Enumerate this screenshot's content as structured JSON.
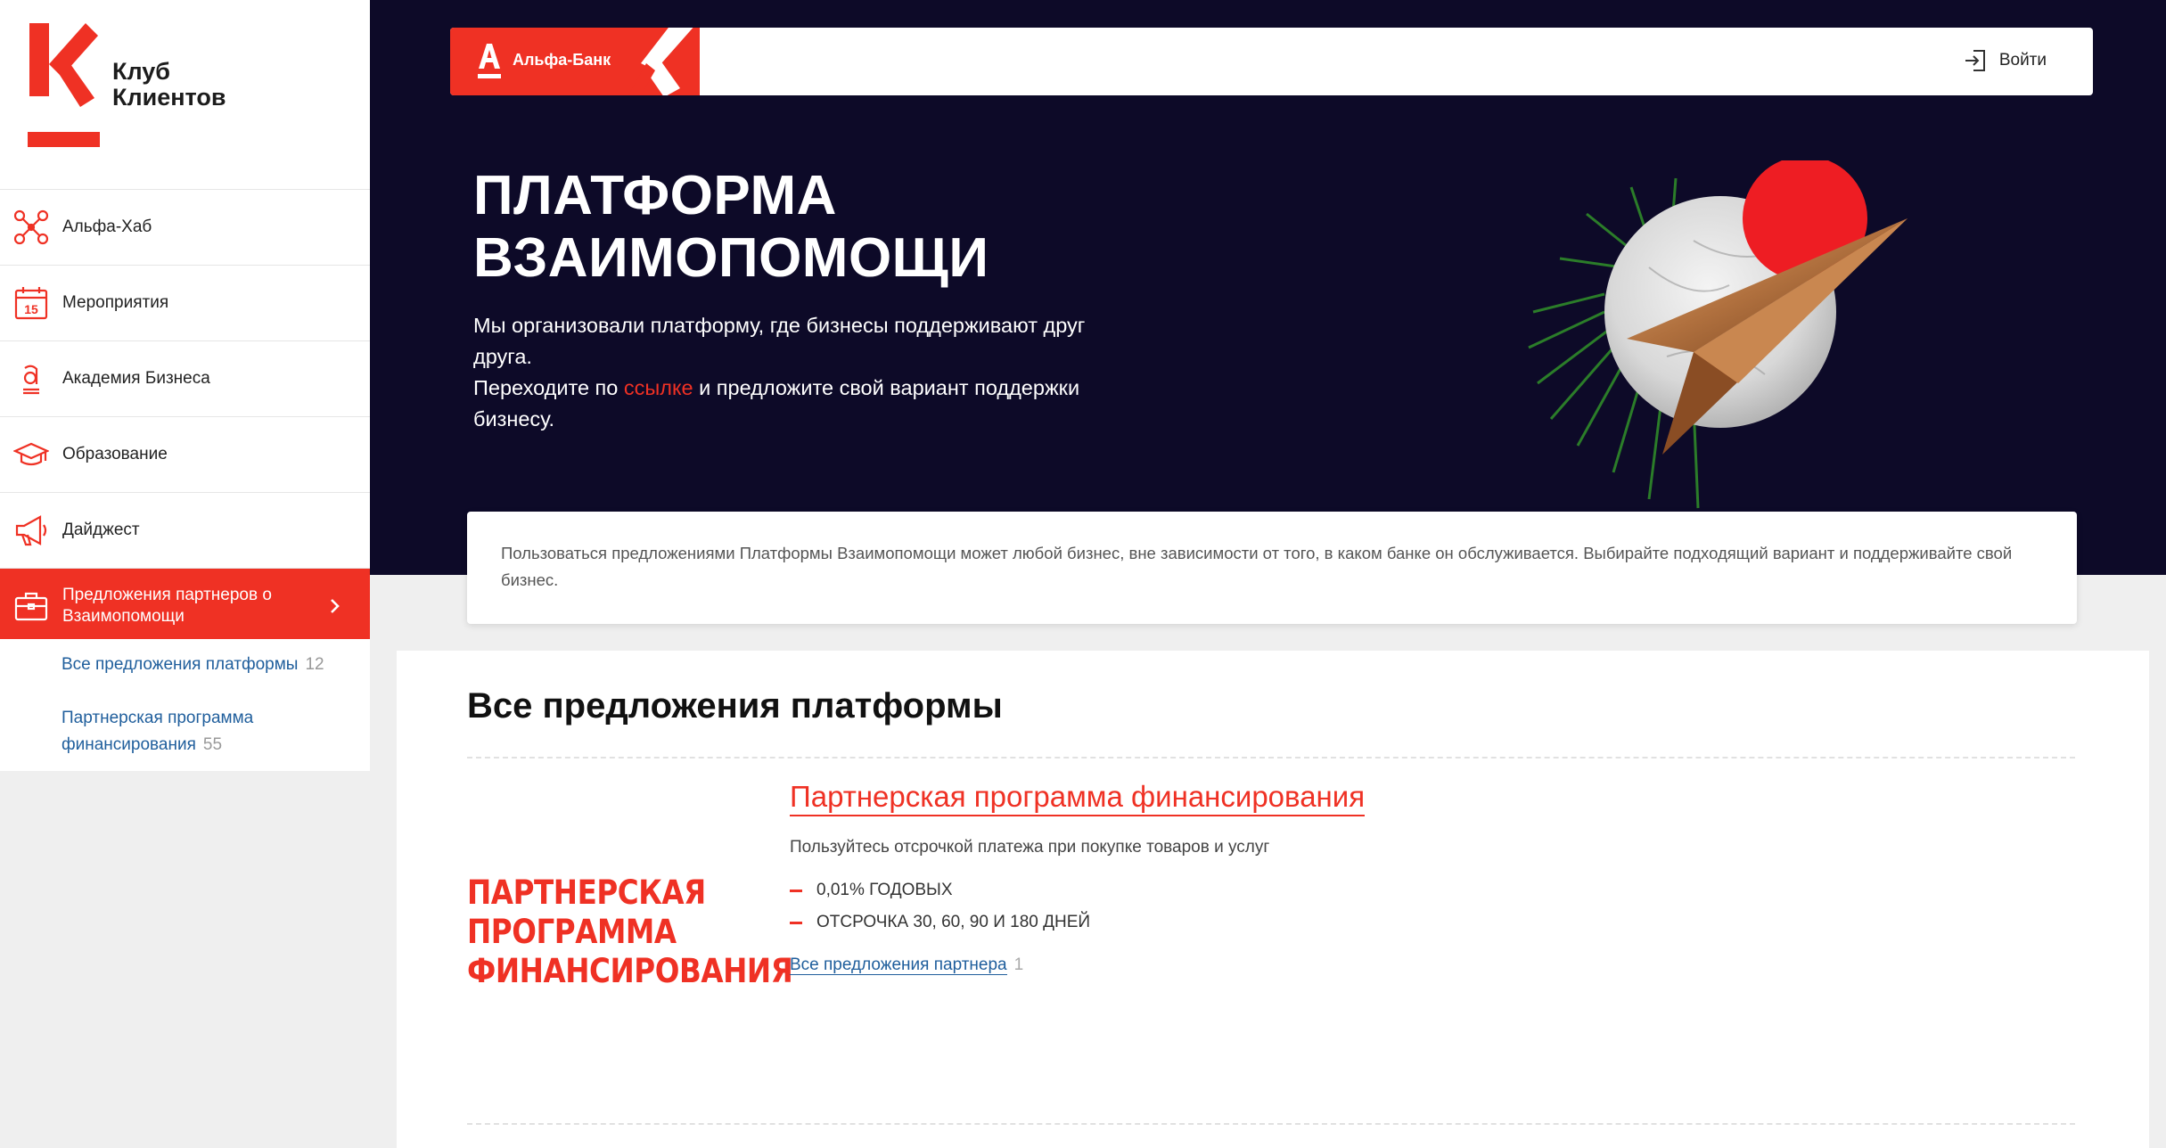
{
  "logo": {
    "line1": "Клуб",
    "line2": "Клиентов"
  },
  "sidebar": {
    "items": [
      {
        "label": "Альфа-Хаб",
        "icon": "network-hub-icon"
      },
      {
        "label": "Мероприятия",
        "icon": "calendar-icon",
        "calendar_day": "15"
      },
      {
        "label": "Академия Бизнеса",
        "icon": "academy-a-icon"
      },
      {
        "label": "Образование",
        "icon": "graduation-cap-icon"
      },
      {
        "label": "Дайджест",
        "icon": "megaphone-icon"
      },
      {
        "label": "Предложения партнеров о Взаимопомощи",
        "icon": "briefcase-icon",
        "active": true
      }
    ],
    "sub_items": [
      {
        "label": "Все предложения платформы",
        "count": "12"
      },
      {
        "label": "Партнерская программа",
        "label2": "финансирования",
        "count": "55"
      }
    ]
  },
  "header": {
    "brand": "Альфа-Банк",
    "login_label": "Войти"
  },
  "hero": {
    "title_line1": "ПЛАТФОРМА",
    "title_line2": "ВЗАИМОПОМОЩИ",
    "desc_line1": "Мы организовали платформу, где бизнесы поддерживают друг друга.",
    "desc_pre": "Переходите по ",
    "desc_link": "ссылке",
    "desc_post": " и предложите свой вариант поддержки бизнесу."
  },
  "info_text": "Пользоваться предложениями Платформы Взаимопомощи может любой бизнес, вне зависимости от того, в каком банке он обслуживается. Выбирайте подходящий вариант и поддерживайте свой бизнес.",
  "main": {
    "section_title": "Все предложения платформы",
    "offer": {
      "promo_line1": "ПАРТНЕРСКАЯ",
      "promo_line2": "ПРОГРАММА",
      "promo_line3": "ФИНАНСИРОВАНИЯ",
      "title": "Партнерская программа финансирования",
      "desc": "Пользуйтесь отсрочкой платежа при покупке товаров и услуг",
      "bullets": [
        "0,01% ГОДОВЫХ",
        "ОТСРОЧКА 30, 60, 90 И 180 ДНЕЙ"
      ],
      "partner_link": "Все предложения партнера",
      "partner_count": "1"
    }
  },
  "colors": {
    "accent": "#ef3124",
    "hero_bg": "#0d0a28",
    "link": "#1f5e9c"
  }
}
